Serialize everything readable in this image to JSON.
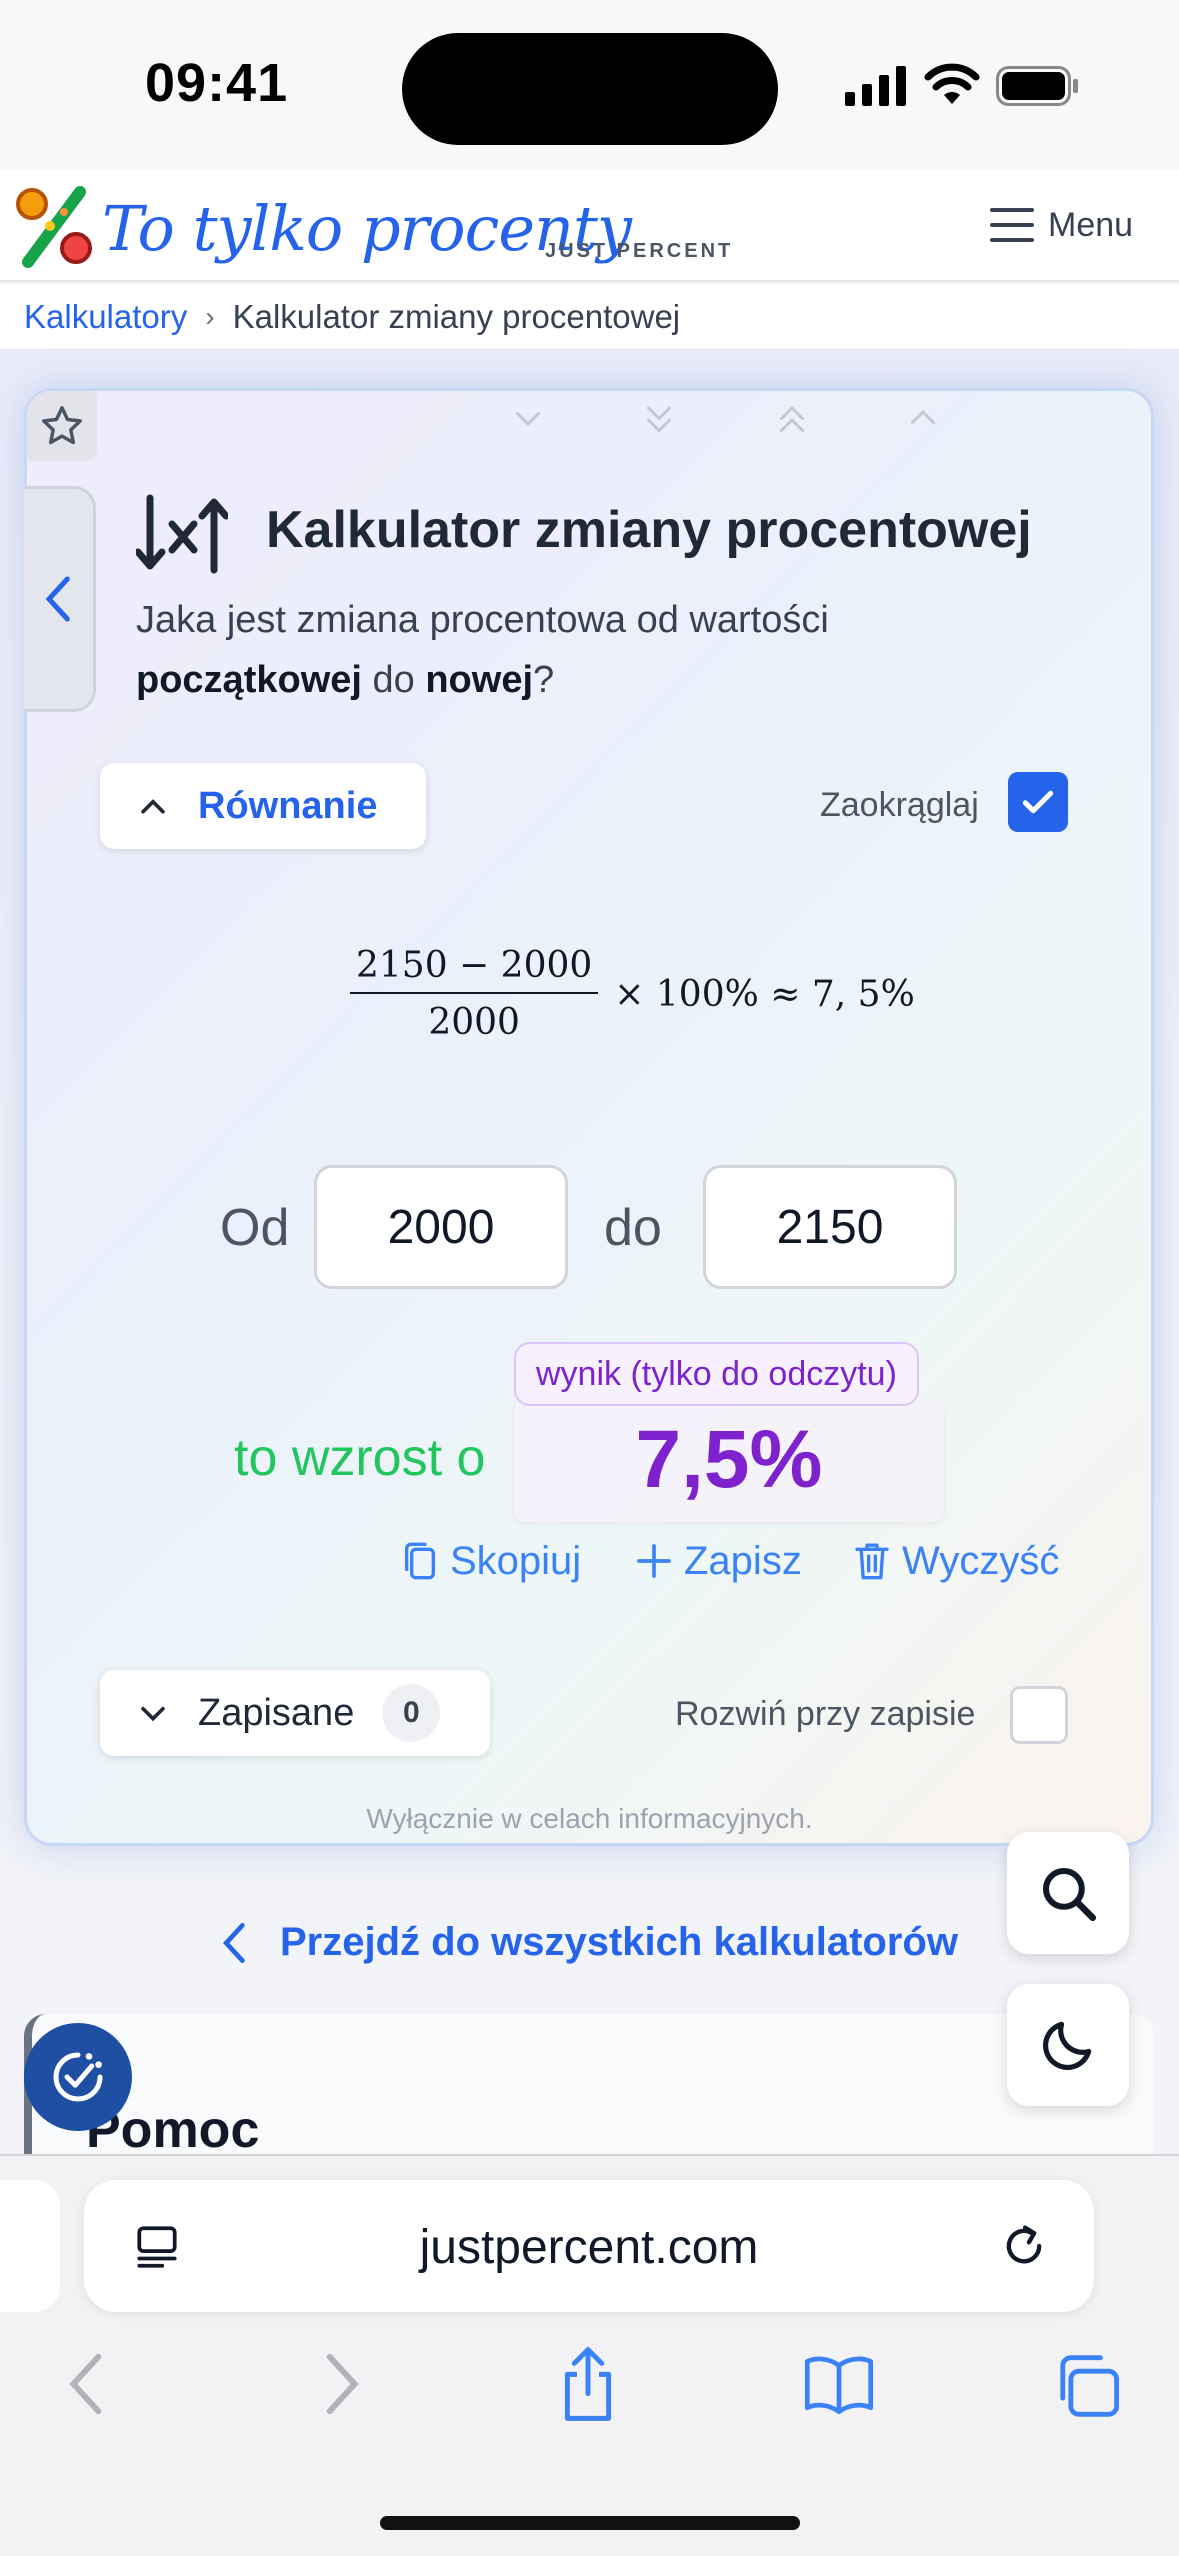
{
  "status_bar": {
    "time": "09:41"
  },
  "header": {
    "logo_mark": "%",
    "logo_text": "To tylko procenty",
    "logo_sub": "JUST PERCENT",
    "menu_label": "Menu"
  },
  "breadcrumb": {
    "root": "Kalkulatory",
    "separator": "›",
    "current": "Kalkulator zmiany procentowej"
  },
  "calculator": {
    "title": "Kalkulator zmiany procentowej",
    "desc_part1": "Jaka jest zmiana procentowa od wartości ",
    "desc_bold1": "początkowej",
    "desc_part2": " do ",
    "desc_bold2": "nowej",
    "desc_part3": "?",
    "equation_label": "Równanie",
    "round_label": "Zaokrąglaj",
    "round_checked": true,
    "formula": {
      "numerator": "2150 − 2000",
      "denominator": "2000",
      "rest": "× 100% ≈ 7, 5%"
    },
    "from_label": "Od",
    "from_value": "2000",
    "to_label": "do",
    "to_value": "2150",
    "result_prefix": "to wzrost o",
    "result_badge": "wynik (tylko do odczytu)",
    "result_value": "7,5%",
    "copy_label": "Skopiuj",
    "save_label": "Zapisz",
    "clear_label": "Wyczyść",
    "saved_label": "Zapisane",
    "saved_count": "0",
    "expand_label": "Rozwiń przy zapisie",
    "expand_checked": false,
    "disclaimer": "Wyłącznie w celach informacyjnych."
  },
  "links": {
    "all_calculators": "Przejdź do wszystkich kalkulatorów"
  },
  "help": {
    "title": "Pomoc"
  },
  "browser": {
    "url": "justpercent.com"
  },
  "colors": {
    "accent": "#2563eb",
    "result": "#7e22ce",
    "increase": "#22c55e"
  }
}
